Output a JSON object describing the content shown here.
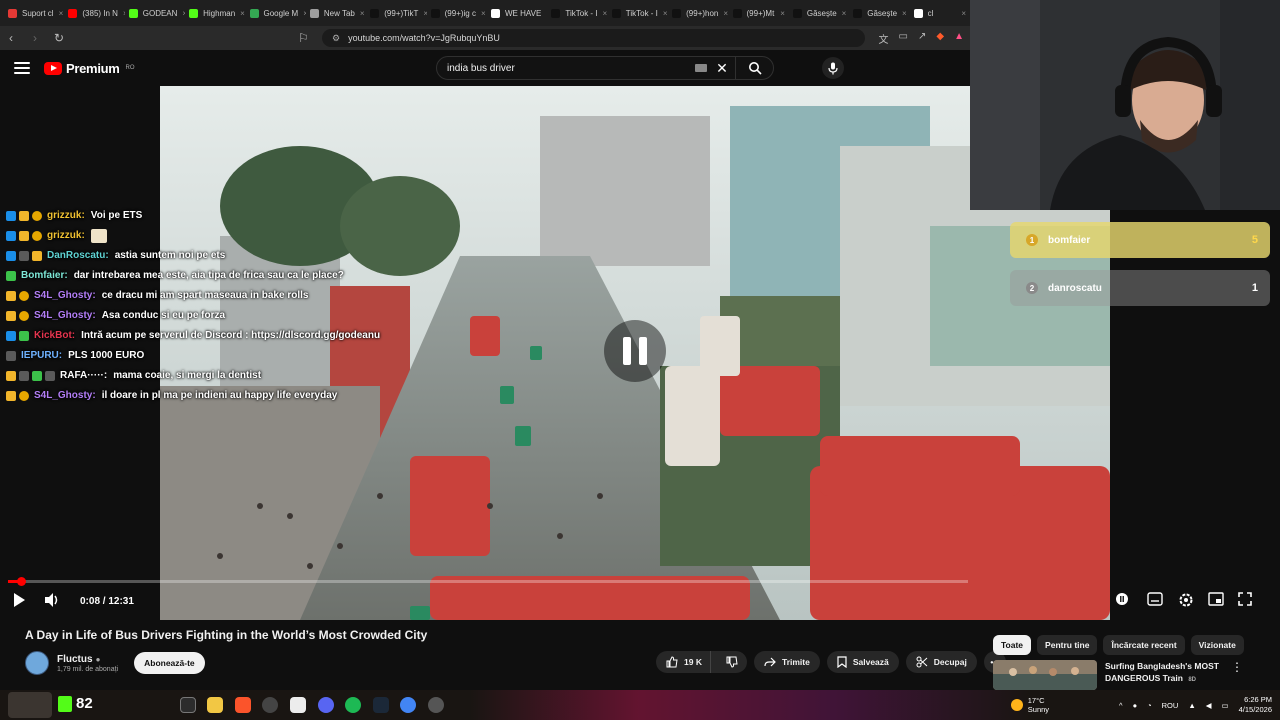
{
  "browser": {
    "tabs": [
      {
        "label": "Suport cl",
        "color": "#e53935"
      },
      {
        "label": "(385) In N",
        "color": "#ff0000"
      },
      {
        "label": "GODEAN",
        "color": "#53fc18"
      },
      {
        "label": "Highman",
        "color": "#53fc18"
      },
      {
        "label": "Google M",
        "color": "#34a853"
      },
      {
        "label": "New Tab",
        "color": "#9e9e9e"
      },
      {
        "label": "(99+)TikT",
        "color": "#111111"
      },
      {
        "label": "(99+)ig c",
        "color": "#111111"
      },
      {
        "label": "WE HAVE",
        "color": "#ffffff"
      },
      {
        "label": "TikTok - I",
        "color": "#111111"
      },
      {
        "label": "TikTok - I",
        "color": "#111111"
      },
      {
        "label": "(99+)hon",
        "color": "#111111"
      },
      {
        "label": "(99+)Mt",
        "color": "#111111"
      },
      {
        "label": "Găsește",
        "color": "#111111"
      },
      {
        "label": "Găsește",
        "color": "#111111"
      },
      {
        "label": "cl",
        "color": "#ffffff"
      }
    ],
    "url": "youtube.com/watch?v=JgRubquYnBU"
  },
  "youtube": {
    "logo_text": "Premium",
    "logo_region": "RO",
    "search_value": "india bus driver"
  },
  "player": {
    "time": "0:08 / 12:31",
    "progress": 0.011
  },
  "chat": [
    {
      "badges": [
        "mod",
        "crown",
        "coin"
      ],
      "user": "grizzuk:",
      "user_color": "#f1c232",
      "text": "Voi pe ETS"
    },
    {
      "badges": [
        "mod",
        "crown",
        "coin"
      ],
      "user": "grizzuk:",
      "user_color": "#f1c232",
      "text": "",
      "emote": true
    },
    {
      "badges": [
        "mod",
        "sq",
        "crown"
      ],
      "user": "DanRoscatu:",
      "user_color": "#5fd3d3",
      "text": "astia suntem noi pe ets"
    },
    {
      "badges": [
        "green"
      ],
      "user": "Bomfaier:",
      "user_color": "#7ee8d8",
      "text": "dar intrebarea mea este, aia tipa de frica sau ca le place?"
    },
    {
      "badges": [
        "crown",
        "coin"
      ],
      "user": "S4L_Ghosty:",
      "user_color": "#b37ef7",
      "text": "ce dracu mi am spart maseaua in bake rolls"
    },
    {
      "badges": [
        "crown",
        "coin"
      ],
      "user": "S4L_Ghosty:",
      "user_color": "#b37ef7",
      "text": "Asa conduc si eu pe forza"
    },
    {
      "badges": [
        "mod",
        "green"
      ],
      "user": "KickBot:",
      "user_color": "#e5354f",
      "text": "Intră acum pe serverul de Discord : https://dlscord.gg/godeanu",
      "wrap": true
    },
    {
      "badges": [
        "sq"
      ],
      "user": "IEPURU:",
      "user_color": "#6fb2ff",
      "text": "PLS 1000 EURO"
    },
    {
      "badges": [
        "crown",
        "sq",
        "green",
        "sq"
      ],
      "user": "RAFA·····:",
      "user_color": "#ffffff",
      "text": "mama coaie, si mergi la dentist"
    },
    {
      "badges": [
        "crown",
        "coin"
      ],
      "user": "S4L_Ghosty:",
      "user_color": "#b37ef7",
      "text": "il doare in pl ma pe indieni au happy life everyday"
    }
  ],
  "leaderboard": [
    {
      "rank": "1",
      "name": "bomfaier",
      "score": "5"
    },
    {
      "rank": "2",
      "name": "danroscatu",
      "score": "1"
    }
  ],
  "video": {
    "title": "A Day in Life of Bus Drivers Fighting in the World’s Most Crowded City",
    "channel": "Fluctus",
    "subscribers": "1,79 mil. de abonați",
    "subscribe": "Abonează-te",
    "likes": "19 K",
    "share": "Trimite",
    "save": "Salvează",
    "clip": "Decupaj"
  },
  "chips": [
    {
      "label": "Toate",
      "active": true
    },
    {
      "label": "Pentru tine",
      "active": false
    },
    {
      "label": "Încărcate recent",
      "active": false
    },
    {
      "label": "Vizionate",
      "active": false
    }
  ],
  "recommended": {
    "title": "Surfing Bangladesh's MOST DANGEROUS Train",
    "quality": "8D"
  },
  "taskbar": {
    "kick_count": "82",
    "weather_temp": "17°C",
    "weather_text": "Sunny",
    "lang": "ROU",
    "time": "6:26 PM",
    "date": "4/15/2026"
  },
  "colors": {
    "accent_red": "#ff0000",
    "kick_green": "#53fc18",
    "leaderboard_gold": "#ffd84a"
  }
}
